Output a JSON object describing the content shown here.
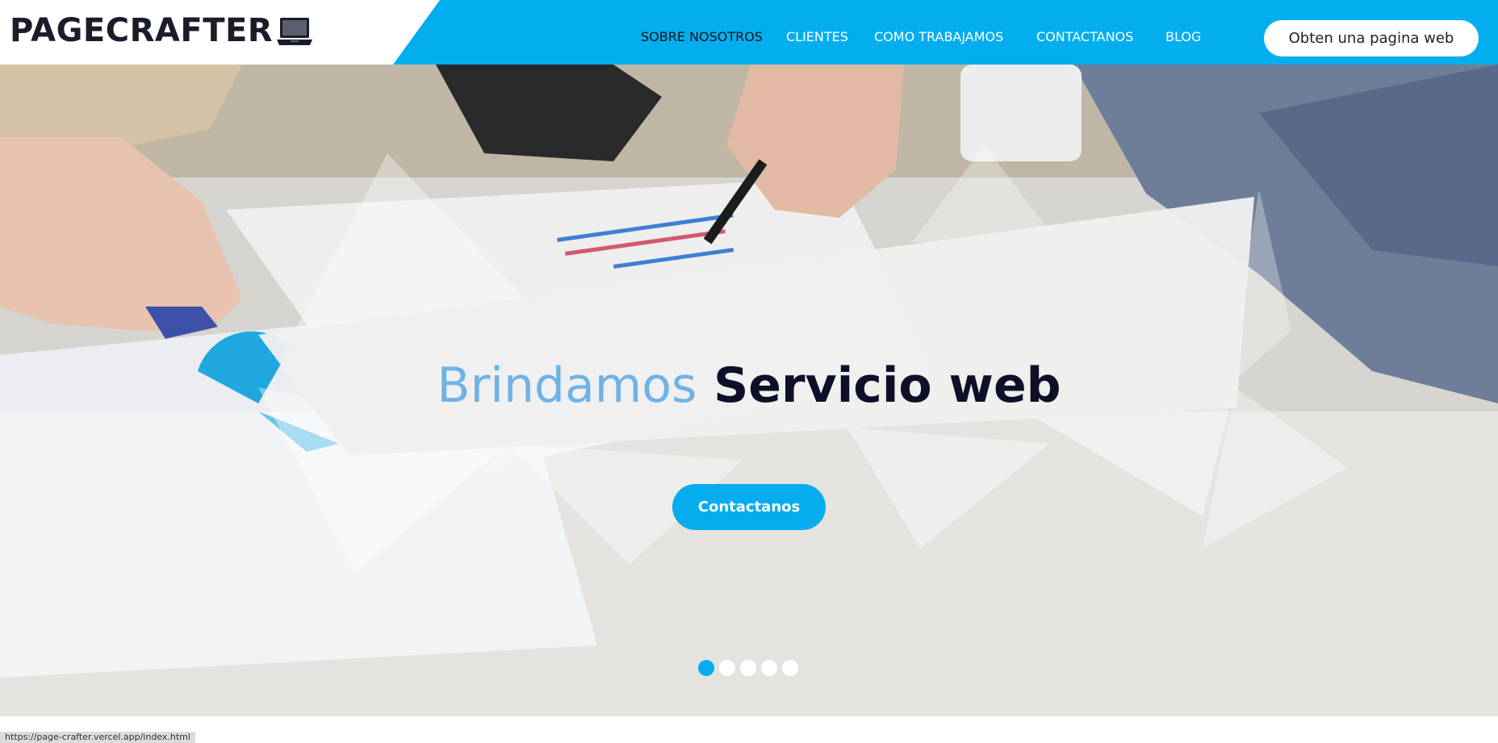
{
  "brand": {
    "name": "PAGECRAFTER",
    "icon": "laptop-icon"
  },
  "nav": {
    "items": [
      {
        "label": "SOBRE NOSOTROS",
        "active": true
      },
      {
        "label": "CLIENTES",
        "active": false
      },
      {
        "label": "COMO TRABAJAMOS",
        "active": false
      },
      {
        "label": "CONTACTANOS",
        "active": false
      },
      {
        "label": "BLOG",
        "active": false
      }
    ],
    "cta_label": "Obten una pagina web"
  },
  "hero": {
    "title_light": "Brindamos",
    "title_bold": "Servicio web",
    "button_label": "Contactanos",
    "slides_count": 5,
    "active_slide": 1
  },
  "status": {
    "url": "https://page-crafter.vercel.app/index.html"
  },
  "colors": {
    "accent": "#03aeef",
    "title_light": "#6fb2e6",
    "title_dark": "#0d1028"
  }
}
